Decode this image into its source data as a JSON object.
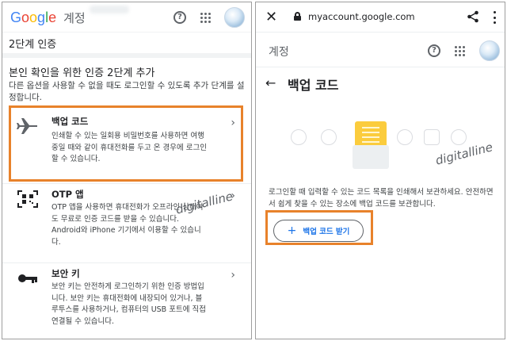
{
  "left": {
    "brand_letters": [
      "G",
      "o",
      "o",
      "g",
      "l",
      "e"
    ],
    "account_label": "계정",
    "section_title": "2단계 인증",
    "intro_title": "본인 확인을 위한 인증 2단계 추가",
    "intro_desc": "다른 옵션을 사용할 수 없을 때도 로그인할 수 있도록 추가 단계를 설정합니다.",
    "methods": [
      {
        "title": "백업 코드",
        "desc": "인쇄할 수 있는 일회용 비밀번호를 사용하면 여행 중일 때와 같이 휴대전화를 두고 온 경우에 로그인할 수 있습니다.",
        "icon": "airplane-icon"
      },
      {
        "title": "OTP 앱",
        "desc": "OTP 앱을 사용하면 휴대전화가 오프라인 상태여도 무료로 인증 코드를 받을 수 있습니다. Android와 iPhone 기기에서 이용할 수 있습니다.",
        "icon": "qr-scan-icon"
      },
      {
        "title": "보안 키",
        "desc": "보안 키는 안전하게 로그인하기 위한 인증 방법입니다. 보안 키는 휴대전화에 내장되어 있거나, 블루투스를 사용하거나, 컴퓨터의 USB 포트에 직접 연결될 수 있습니다.",
        "icon": "key-icon"
      }
    ],
    "watermark": "digitalline"
  },
  "right": {
    "url": "myaccount.google.com",
    "account_label": "계정",
    "page_title": "백업 코드",
    "desc": "로그인할 때 입력할 수 있는 코드 목록을 인쇄해서 보관하세요. 안전하면서 쉽게 찾을 수 있는 장소에 백업 코드를 보관합니다.",
    "button_label": "백업 코드 받기",
    "button_icon": "+",
    "watermark": "digitalline"
  },
  "colors": {
    "highlight": "#e8822b",
    "accent_blue": "#1a73e8",
    "code_yellow": "#fbcc3d"
  }
}
